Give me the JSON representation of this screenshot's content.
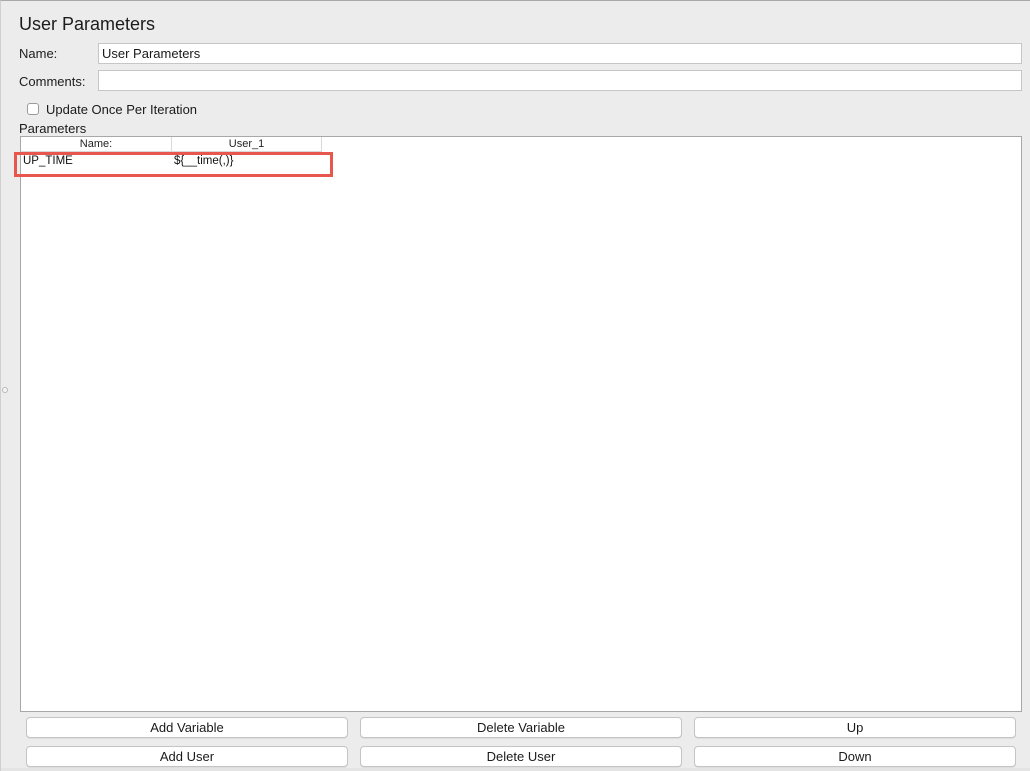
{
  "panel": {
    "title": "User Parameters"
  },
  "form": {
    "name_label": "Name:",
    "name_value": "User Parameters",
    "comments_label": "Comments:",
    "comments_value": "",
    "update_once_label": "Update Once Per Iteration",
    "update_once_checked": false
  },
  "parameters": {
    "section_label": "Parameters",
    "columns": [
      "Name:",
      "User_1"
    ],
    "rows": [
      [
        "UP_TIME",
        "${__time(,)}"
      ]
    ]
  },
  "buttons": {
    "add_variable": "Add Variable",
    "delete_variable": "Delete Variable",
    "up": "Up",
    "add_user": "Add User",
    "delete_user": "Delete User",
    "down": "Down"
  },
  "colors": {
    "highlight": "#e8574d"
  }
}
